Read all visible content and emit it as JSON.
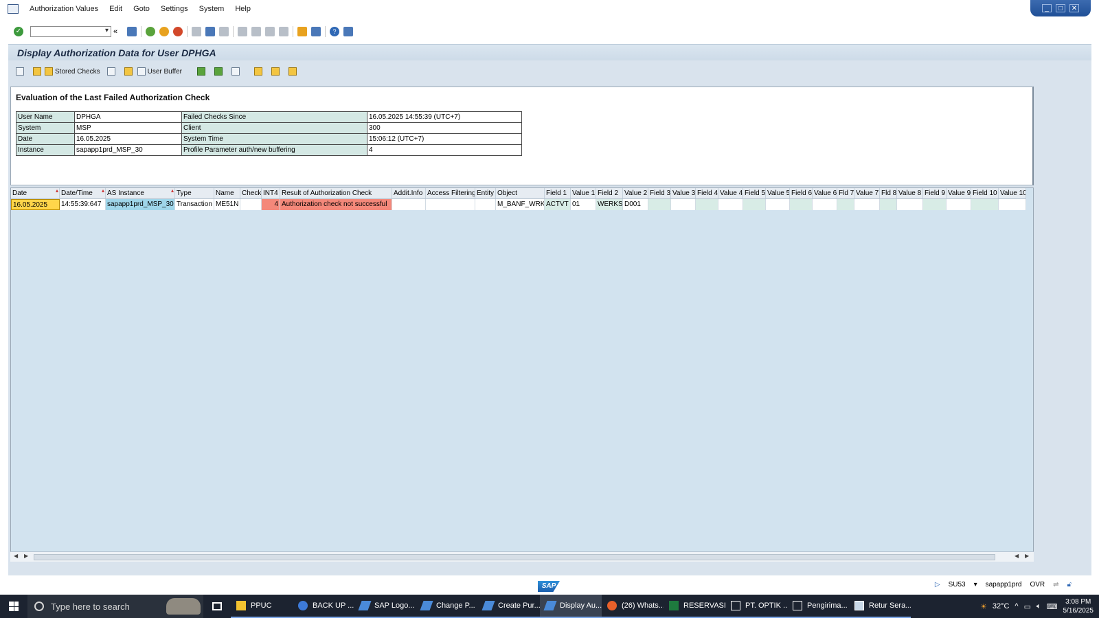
{
  "menu": {
    "items": [
      "Authorization Values",
      "Edit",
      "Goto",
      "Settings",
      "System",
      "Help"
    ],
    "window_controls": [
      "_",
      "□",
      "✕"
    ]
  },
  "page": {
    "title": "Display Authorization Data for User DPHGA"
  },
  "app_toolbar": {
    "stored_checks": "Stored Checks",
    "user_buffer": "User Buffer"
  },
  "evaluation": {
    "heading": "Evaluation of the Last Failed Authorization Check",
    "rows": [
      {
        "k1": "User Name",
        "v1": "DPHGA",
        "k2": "Failed Checks Since",
        "v2": "16.05.2025 14:55:39 (UTC+7)"
      },
      {
        "k1": "System",
        "v1": "MSP",
        "k2": "Client",
        "v2": "300"
      },
      {
        "k1": "Date",
        "v1": "16.05.2025",
        "k2": "System Time",
        "v2": "15:06:12 (UTC+7)"
      },
      {
        "k1": "Instance",
        "v1": "sapapp1prd_MSP_30",
        "k2": "Profile Parameter auth/new buffering",
        "v2": "4"
      }
    ]
  },
  "grid": {
    "columns": [
      "Date",
      "Date/Time",
      "AS Instance",
      "Type",
      "Name",
      "Check",
      "INT4",
      "Result of Authorization Check",
      "Addit.Info",
      "Access Filtering",
      "Entity",
      "Object",
      "Field 1",
      "Value 1",
      "Field 2",
      "Value 2",
      "Field 3",
      "Value 3",
      "Field 4",
      "Value 4",
      "Field 5",
      "Value 5",
      "Field 6",
      "Value 6",
      "Fld 7",
      "Value 7",
      "Fld 8",
      "Value 8",
      "Field 9",
      "Value 9",
      "Field 10",
      "Value 10"
    ],
    "row": {
      "date": "16.05.2025",
      "datetime": "14:55:39:647",
      "as_instance": "sapapp1prd_MSP_30",
      "type": "Transaction",
      "name": "ME51N",
      "check": "",
      "int4": "4",
      "result": "Authorization check not successful",
      "addit_info": "",
      "access_filtering": "",
      "entity": "",
      "object": "M_BANF_WRK",
      "field1": "ACTVT",
      "value1": "01",
      "field2": "WERKS",
      "value2": "D001"
    }
  },
  "status": {
    "logo": "SAP",
    "tcode": "SU53",
    "server": "sapapp1prd",
    "mode": "OVR"
  },
  "taskbar": {
    "search_placeholder": "Type here to search",
    "apps": [
      "PPUC",
      "BACK UP ...",
      "SAP Logo...",
      "Change P...",
      "Create Pur...",
      "Display Au...",
      "(26) Whats...",
      "RESERVASI...",
      "PT. OPTIK ...",
      "Pengirima...",
      "Retur Sera..."
    ],
    "temperature": "32°C",
    "time": "3:08 PM",
    "date": "5/16/2025"
  },
  "colors": {
    "accent": "#d9e3ed",
    "selected": "#ffd64a",
    "error": "#f4887a",
    "key_cell": "#d4e8e4"
  }
}
